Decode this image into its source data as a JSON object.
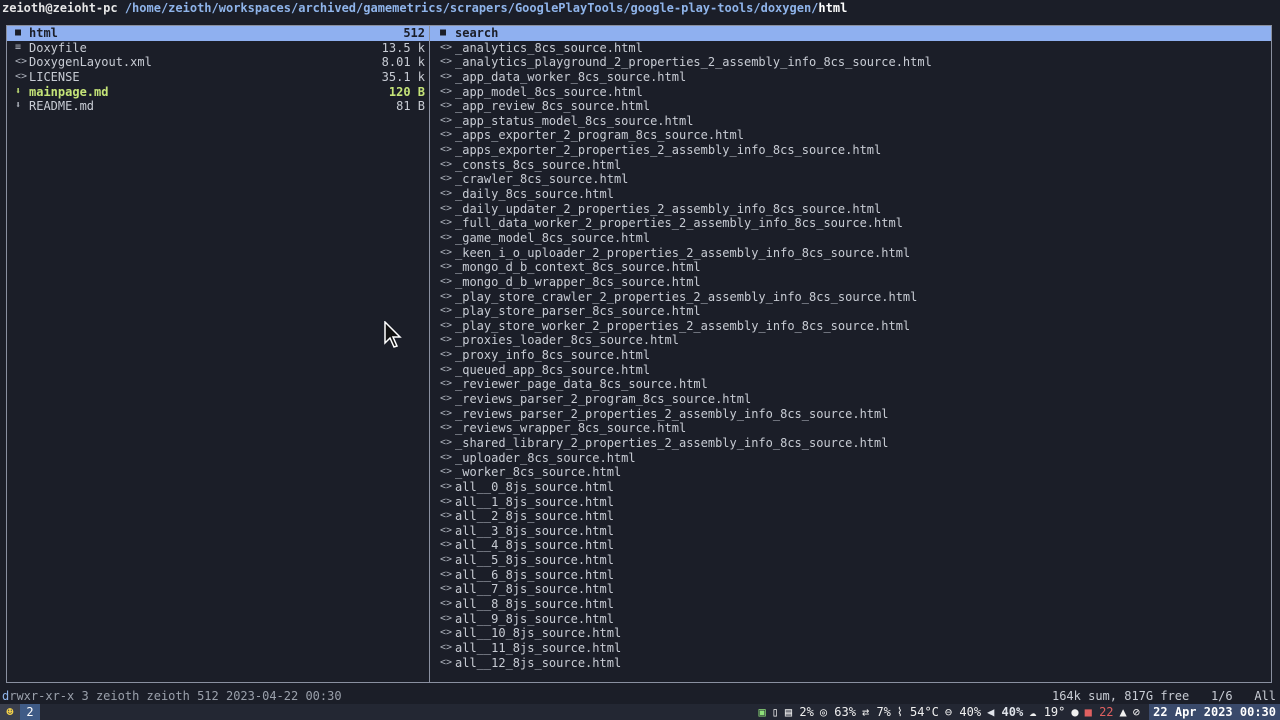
{
  "title": {
    "host": "zeioth@zeioht-pc",
    "path": "/home/zeioth/workspaces/archived/gamemetrics/scrapers/GooglePlayTools/google-play-tools/doxygen/",
    "current": "html"
  },
  "left_pane": {
    "items": [
      {
        "icon": "folder-icon",
        "glyph": "■",
        "name": "html",
        "size": "512",
        "selected": true
      },
      {
        "icon": "text-file-icon",
        "glyph": "≡",
        "name": "Doxyfile",
        "size": "13.5 k"
      },
      {
        "icon": "code-file-icon",
        "glyph": "<>",
        "name": "DoxygenLayout.xml",
        "size": "8.01 k"
      },
      {
        "icon": "code-file-icon",
        "glyph": "<>",
        "name": "LICENSE",
        "size": "35.1 k"
      },
      {
        "icon": "markdown-file-icon",
        "glyph": "⬇",
        "name": "mainpage.md",
        "size": "120 B",
        "highlight": true
      },
      {
        "icon": "markdown-file-icon",
        "glyph": "⬇",
        "name": "README.md",
        "size": "81 B"
      }
    ]
  },
  "right_pane": {
    "items": [
      {
        "glyph": "■",
        "name": "search",
        "selected": true
      },
      {
        "glyph": "<>",
        "name": "_analytics_8cs_source.html"
      },
      {
        "glyph": "<>",
        "name": "_analytics_playground_2_properties_2_assembly_info_8cs_source.html"
      },
      {
        "glyph": "<>",
        "name": "_app_data_worker_8cs_source.html"
      },
      {
        "glyph": "<>",
        "name": "_app_model_8cs_source.html"
      },
      {
        "glyph": "<>",
        "name": "_app_review_8cs_source.html"
      },
      {
        "glyph": "<>",
        "name": "_app_status_model_8cs_source.html"
      },
      {
        "glyph": "<>",
        "name": "_apps_exporter_2_program_8cs_source.html"
      },
      {
        "glyph": "<>",
        "name": "_apps_exporter_2_properties_2_assembly_info_8cs_source.html"
      },
      {
        "glyph": "<>",
        "name": "_consts_8cs_source.html"
      },
      {
        "glyph": "<>",
        "name": "_crawler_8cs_source.html"
      },
      {
        "glyph": "<>",
        "name": "_daily_8cs_source.html"
      },
      {
        "glyph": "<>",
        "name": "_daily_updater_2_properties_2_assembly_info_8cs_source.html"
      },
      {
        "glyph": "<>",
        "name": "_full_data_worker_2_properties_2_assembly_info_8cs_source.html"
      },
      {
        "glyph": "<>",
        "name": "_game_model_8cs_source.html"
      },
      {
        "glyph": "<>",
        "name": "_keen_i_o_uploader_2_properties_2_assembly_info_8cs_source.html"
      },
      {
        "glyph": "<>",
        "name": "_mongo_d_b_context_8cs_source.html"
      },
      {
        "glyph": "<>",
        "name": "_mongo_d_b_wrapper_8cs_source.html"
      },
      {
        "glyph": "<>",
        "name": "_play_store_crawler_2_properties_2_assembly_info_8cs_source.html"
      },
      {
        "glyph": "<>",
        "name": "_play_store_parser_8cs_source.html"
      },
      {
        "glyph": "<>",
        "name": "_play_store_worker_2_properties_2_assembly_info_8cs_source.html"
      },
      {
        "glyph": "<>",
        "name": "_proxies_loader_8cs_source.html"
      },
      {
        "glyph": "<>",
        "name": "_proxy_info_8cs_source.html"
      },
      {
        "glyph": "<>",
        "name": "_queued_app_8cs_source.html"
      },
      {
        "glyph": "<>",
        "name": "_reviewer_page_data_8cs_source.html"
      },
      {
        "glyph": "<>",
        "name": "_reviews_parser_2_program_8cs_source.html"
      },
      {
        "glyph": "<>",
        "name": "_reviews_parser_2_properties_2_assembly_info_8cs_source.html"
      },
      {
        "glyph": "<>",
        "name": "_reviews_wrapper_8cs_source.html"
      },
      {
        "glyph": "<>",
        "name": "_shared_library_2_properties_2_assembly_info_8cs_source.html"
      },
      {
        "glyph": "<>",
        "name": "_uploader_8cs_source.html"
      },
      {
        "glyph": "<>",
        "name": "_worker_8cs_source.html"
      },
      {
        "glyph": "<>",
        "name": "all__0_8js_source.html"
      },
      {
        "glyph": "<>",
        "name": "all__1_8js_source.html"
      },
      {
        "glyph": "<>",
        "name": "all__2_8js_source.html"
      },
      {
        "glyph": "<>",
        "name": "all__3_8js_source.html"
      },
      {
        "glyph": "<>",
        "name": "all__4_8js_source.html"
      },
      {
        "glyph": "<>",
        "name": "all__5_8js_source.html"
      },
      {
        "glyph": "<>",
        "name": "all__6_8js_source.html"
      },
      {
        "glyph": "<>",
        "name": "all__7_8js_source.html"
      },
      {
        "glyph": "<>",
        "name": "all__8_8js_source.html"
      },
      {
        "glyph": "<>",
        "name": "all__9_8js_source.html"
      },
      {
        "glyph": "<>",
        "name": "all__10_8js_source.html"
      },
      {
        "glyph": "<>",
        "name": "all__11_8js_source.html"
      },
      {
        "glyph": "<>",
        "name": "all__12_8js_source.html"
      }
    ]
  },
  "status": {
    "perm_dir": "d",
    "perm_rest": "rwxr-xr-x",
    "info": " 3 zeioth zeioth 512 2023-04-22 00:30",
    "disk": "164k sum, 817G free",
    "position": "1/6",
    "scroll": "All"
  },
  "bar": {
    "workspace": "2",
    "stats": [
      {
        "icon": "calendar-icon",
        "glyph": "▣",
        "text": "",
        "cls": "g"
      },
      {
        "icon": "clipboard-icon",
        "glyph": "▯",
        "text": "",
        "cls": "b"
      },
      {
        "icon": "cpu-icon",
        "glyph": "▤",
        "text": "2%",
        "cls": "b"
      },
      {
        "icon": "memory-icon",
        "glyph": "◎",
        "text": "63%",
        "cls": "b"
      },
      {
        "icon": "network-icon",
        "glyph": "⇄",
        "text": "7%",
        "cls": "b"
      },
      {
        "icon": "thermometer-icon",
        "glyph": "⌇",
        "text": "54°C",
        "cls": "b"
      },
      {
        "icon": "disk-icon",
        "glyph": "⊖",
        "text": "40%",
        "cls": "b"
      },
      {
        "icon": "volume-icon",
        "glyph": "◀",
        "text": "40%",
        "cls": "bold"
      },
      {
        "icon": "weather-icon",
        "glyph": "☁",
        "text": "19°",
        "cls": "b"
      },
      {
        "icon": "bulb-icon",
        "glyph": "●",
        "text": "",
        "cls": "b"
      },
      {
        "icon": "updates-icon",
        "glyph": "■",
        "text": "22",
        "cls": "red"
      },
      {
        "icon": "bell-icon",
        "glyph": "▲",
        "text": "",
        "cls": "b"
      },
      {
        "icon": "power-icon",
        "glyph": "⊘",
        "text": "",
        "cls": "b"
      }
    ],
    "date": "22 Apr 2023 00:30"
  }
}
